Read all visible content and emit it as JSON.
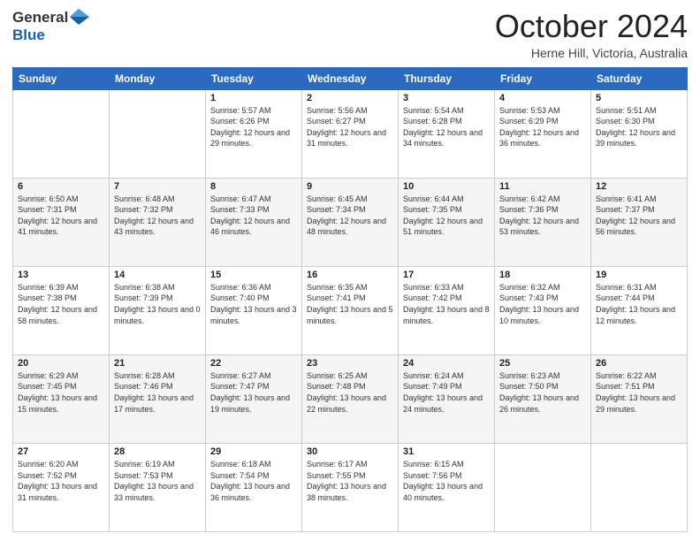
{
  "header": {
    "logo": {
      "general": "General",
      "blue": "Blue"
    },
    "title": "October 2024",
    "location": "Herne Hill, Victoria, Australia"
  },
  "days_of_week": [
    "Sunday",
    "Monday",
    "Tuesday",
    "Wednesday",
    "Thursday",
    "Friday",
    "Saturday"
  ],
  "weeks": [
    [
      {
        "day": "",
        "sunrise": "",
        "sunset": "",
        "daylight": ""
      },
      {
        "day": "",
        "sunrise": "",
        "sunset": "",
        "daylight": ""
      },
      {
        "day": "1",
        "sunrise": "Sunrise: 5:57 AM",
        "sunset": "Sunset: 6:26 PM",
        "daylight": "Daylight: 12 hours and 29 minutes."
      },
      {
        "day": "2",
        "sunrise": "Sunrise: 5:56 AM",
        "sunset": "Sunset: 6:27 PM",
        "daylight": "Daylight: 12 hours and 31 minutes."
      },
      {
        "day": "3",
        "sunrise": "Sunrise: 5:54 AM",
        "sunset": "Sunset: 6:28 PM",
        "daylight": "Daylight: 12 hours and 34 minutes."
      },
      {
        "day": "4",
        "sunrise": "Sunrise: 5:53 AM",
        "sunset": "Sunset: 6:29 PM",
        "daylight": "Daylight: 12 hours and 36 minutes."
      },
      {
        "day": "5",
        "sunrise": "Sunrise: 5:51 AM",
        "sunset": "Sunset: 6:30 PM",
        "daylight": "Daylight: 12 hours and 39 minutes."
      }
    ],
    [
      {
        "day": "6",
        "sunrise": "Sunrise: 6:50 AM",
        "sunset": "Sunset: 7:31 PM",
        "daylight": "Daylight: 12 hours and 41 minutes."
      },
      {
        "day": "7",
        "sunrise": "Sunrise: 6:48 AM",
        "sunset": "Sunset: 7:32 PM",
        "daylight": "Daylight: 12 hours and 43 minutes."
      },
      {
        "day": "8",
        "sunrise": "Sunrise: 6:47 AM",
        "sunset": "Sunset: 7:33 PM",
        "daylight": "Daylight: 12 hours and 46 minutes."
      },
      {
        "day": "9",
        "sunrise": "Sunrise: 6:45 AM",
        "sunset": "Sunset: 7:34 PM",
        "daylight": "Daylight: 12 hours and 48 minutes."
      },
      {
        "day": "10",
        "sunrise": "Sunrise: 6:44 AM",
        "sunset": "Sunset: 7:35 PM",
        "daylight": "Daylight: 12 hours and 51 minutes."
      },
      {
        "day": "11",
        "sunrise": "Sunrise: 6:42 AM",
        "sunset": "Sunset: 7:36 PM",
        "daylight": "Daylight: 12 hours and 53 minutes."
      },
      {
        "day": "12",
        "sunrise": "Sunrise: 6:41 AM",
        "sunset": "Sunset: 7:37 PM",
        "daylight": "Daylight: 12 hours and 56 minutes."
      }
    ],
    [
      {
        "day": "13",
        "sunrise": "Sunrise: 6:39 AM",
        "sunset": "Sunset: 7:38 PM",
        "daylight": "Daylight: 12 hours and 58 minutes."
      },
      {
        "day": "14",
        "sunrise": "Sunrise: 6:38 AM",
        "sunset": "Sunset: 7:39 PM",
        "daylight": "Daylight: 13 hours and 0 minutes."
      },
      {
        "day": "15",
        "sunrise": "Sunrise: 6:36 AM",
        "sunset": "Sunset: 7:40 PM",
        "daylight": "Daylight: 13 hours and 3 minutes."
      },
      {
        "day": "16",
        "sunrise": "Sunrise: 6:35 AM",
        "sunset": "Sunset: 7:41 PM",
        "daylight": "Daylight: 13 hours and 5 minutes."
      },
      {
        "day": "17",
        "sunrise": "Sunrise: 6:33 AM",
        "sunset": "Sunset: 7:42 PM",
        "daylight": "Daylight: 13 hours and 8 minutes."
      },
      {
        "day": "18",
        "sunrise": "Sunrise: 6:32 AM",
        "sunset": "Sunset: 7:43 PM",
        "daylight": "Daylight: 13 hours and 10 minutes."
      },
      {
        "day": "19",
        "sunrise": "Sunrise: 6:31 AM",
        "sunset": "Sunset: 7:44 PM",
        "daylight": "Daylight: 13 hours and 12 minutes."
      }
    ],
    [
      {
        "day": "20",
        "sunrise": "Sunrise: 6:29 AM",
        "sunset": "Sunset: 7:45 PM",
        "daylight": "Daylight: 13 hours and 15 minutes."
      },
      {
        "day": "21",
        "sunrise": "Sunrise: 6:28 AM",
        "sunset": "Sunset: 7:46 PM",
        "daylight": "Daylight: 13 hours and 17 minutes."
      },
      {
        "day": "22",
        "sunrise": "Sunrise: 6:27 AM",
        "sunset": "Sunset: 7:47 PM",
        "daylight": "Daylight: 13 hours and 19 minutes."
      },
      {
        "day": "23",
        "sunrise": "Sunrise: 6:25 AM",
        "sunset": "Sunset: 7:48 PM",
        "daylight": "Daylight: 13 hours and 22 minutes."
      },
      {
        "day": "24",
        "sunrise": "Sunrise: 6:24 AM",
        "sunset": "Sunset: 7:49 PM",
        "daylight": "Daylight: 13 hours and 24 minutes."
      },
      {
        "day": "25",
        "sunrise": "Sunrise: 6:23 AM",
        "sunset": "Sunset: 7:50 PM",
        "daylight": "Daylight: 13 hours and 26 minutes."
      },
      {
        "day": "26",
        "sunrise": "Sunrise: 6:22 AM",
        "sunset": "Sunset: 7:51 PM",
        "daylight": "Daylight: 13 hours and 29 minutes."
      }
    ],
    [
      {
        "day": "27",
        "sunrise": "Sunrise: 6:20 AM",
        "sunset": "Sunset: 7:52 PM",
        "daylight": "Daylight: 13 hours and 31 minutes."
      },
      {
        "day": "28",
        "sunrise": "Sunrise: 6:19 AM",
        "sunset": "Sunset: 7:53 PM",
        "daylight": "Daylight: 13 hours and 33 minutes."
      },
      {
        "day": "29",
        "sunrise": "Sunrise: 6:18 AM",
        "sunset": "Sunset: 7:54 PM",
        "daylight": "Daylight: 13 hours and 36 minutes."
      },
      {
        "day": "30",
        "sunrise": "Sunrise: 6:17 AM",
        "sunset": "Sunset: 7:55 PM",
        "daylight": "Daylight: 13 hours and 38 minutes."
      },
      {
        "day": "31",
        "sunrise": "Sunrise: 6:15 AM",
        "sunset": "Sunset: 7:56 PM",
        "daylight": "Daylight: 13 hours and 40 minutes."
      },
      {
        "day": "",
        "sunrise": "",
        "sunset": "",
        "daylight": ""
      },
      {
        "day": "",
        "sunrise": "",
        "sunset": "",
        "daylight": ""
      }
    ]
  ]
}
